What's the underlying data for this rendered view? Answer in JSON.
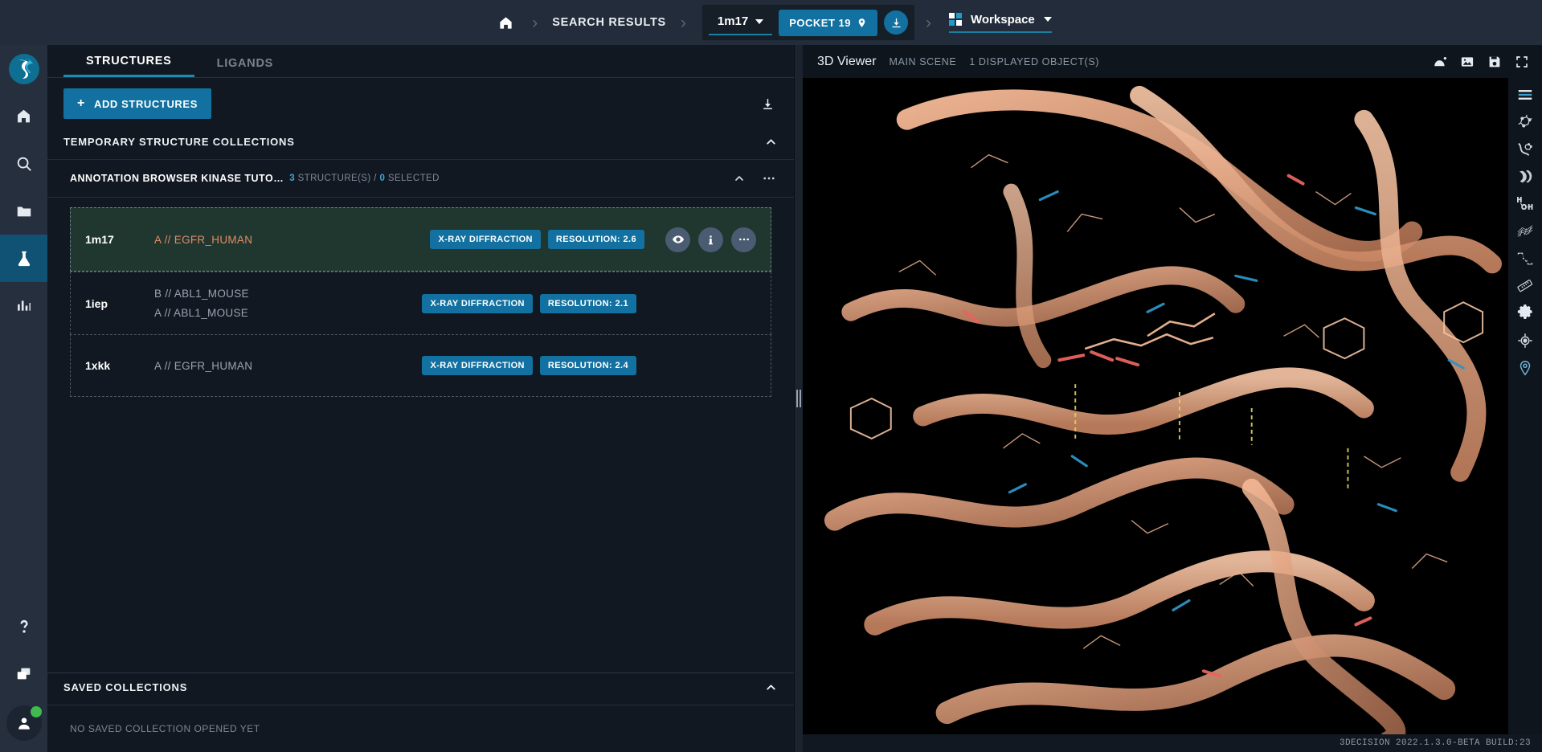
{
  "app": {
    "logo_icon": "3decision-ribbon-logo",
    "status_version": "3DECISION 2022.1.3.0-BETA BUILD:23"
  },
  "topbar": {
    "home_icon": "home-icon",
    "separator": "›",
    "breadcrumb_search_results": "SEARCH RESULTS",
    "structure_selector": "1m17",
    "pocket_button": "POCKET 19",
    "pocket_icon": "map-pin-icon",
    "download_icon": "download-icon",
    "workspace_icon": "grid-icon",
    "workspace_label": "Workspace",
    "workspace_chevron_icon": "chevron-down-icon"
  },
  "rail": {
    "items": [
      {
        "name": "home",
        "icon": "home-icon",
        "active": false
      },
      {
        "name": "search",
        "icon": "search-icon",
        "active": false
      },
      {
        "name": "folders",
        "icon": "folder-icon",
        "active": false
      },
      {
        "name": "structures",
        "icon": "flask-icon",
        "active": true
      },
      {
        "name": "analytics",
        "icon": "bar-chart-icon",
        "active": false
      }
    ],
    "bottom": [
      {
        "name": "help",
        "icon": "question-mark-icon"
      },
      {
        "name": "windows",
        "icon": "windows-copy-icon"
      },
      {
        "name": "account",
        "icon": "user-avatar-icon"
      }
    ]
  },
  "panel": {
    "tabs": [
      {
        "label": "STRUCTURES",
        "active": true
      },
      {
        "label": "LIGANDS",
        "active": false
      }
    ],
    "add_structures_label": "ADD STRUCTURES",
    "add_plus_icon": "plus-icon",
    "download_icon": "download-icon",
    "temporary_section": {
      "title": "TEMPORARY STRUCTURE COLLECTIONS",
      "collapse_icon": "chevron-up-icon"
    },
    "collection": {
      "name": "ANNOTATION BROWSER KINASE TUTO…",
      "count": "3",
      "count_label": "STRUCTURE(S) /",
      "selected_count": "0",
      "selected_label": "SELECTED",
      "collapse_icon": "chevron-up-icon",
      "more_icon": "ellipsis-icon"
    },
    "structures": [
      {
        "pdb_id": "1m17",
        "chains": [
          "A // EGFR_HUMAN"
        ],
        "highlight": true,
        "selected": true,
        "method": "X-RAY DIFFRACTION",
        "resolution": "RESOLUTION: 2.6",
        "actions": [
          "eye-icon",
          "info-icon",
          "ellipsis-icon"
        ]
      },
      {
        "pdb_id": "1iep",
        "chains": [
          "B // ABL1_MOUSE",
          "A // ABL1_MOUSE"
        ],
        "highlight": false,
        "selected": false,
        "method": "X-RAY DIFFRACTION",
        "resolution": "RESOLUTION: 2.1",
        "actions": []
      },
      {
        "pdb_id": "1xkk",
        "chains": [
          "A // EGFR_HUMAN"
        ],
        "highlight": false,
        "selected": false,
        "method": "X-RAY DIFFRACTION",
        "resolution": "RESOLUTION: 2.4",
        "actions": []
      }
    ],
    "saved_section": {
      "title": "SAVED COLLECTIONS",
      "collapse_icon": "chevron-up-icon",
      "empty_text": "NO SAVED COLLECTION OPENED YET"
    }
  },
  "viewer": {
    "title": "3D Viewer",
    "scene_label": "MAIN SCENE",
    "objects_label": "1 DISPLAYED OBJECT(S)",
    "header_icons": [
      "cursor-arc-icon",
      "image-icon",
      "save-icon",
      "fullscreen-icon"
    ],
    "tools": [
      "menu-icon",
      "molecule-icon",
      "ribbon-molecule-icon",
      "helix-icon",
      "water-icon",
      "surface-mesh-icon",
      "distance-icon",
      "ruler-icon",
      "gear-icon",
      "center-target-icon",
      "pin-light-icon"
    ]
  },
  "colors": {
    "accent": "#1271a0",
    "accent_underline": "#1a7fa0",
    "panel_bg": "#121821",
    "topbar_bg": "#222c3a",
    "rail_bg": "#252f3d",
    "selected_row_bg": "#20372f",
    "chain_highlight": "#e08b66",
    "online_dot": "#3fb950",
    "canvas_bg": "#000000",
    "protein_ribbon": "#f3b394"
  }
}
